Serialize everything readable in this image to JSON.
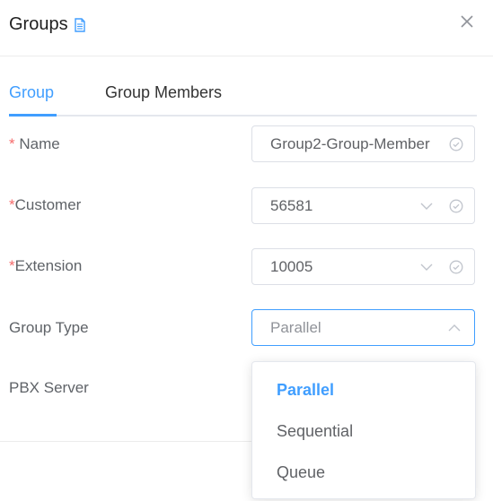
{
  "dialog": {
    "title": "Groups"
  },
  "tabs": [
    {
      "label": "Group",
      "active": true
    },
    {
      "label": "Group Members",
      "active": false
    }
  ],
  "form": {
    "name": {
      "required_mark": "* ",
      "label": "Name",
      "value": "Group2-Group-Member"
    },
    "customer": {
      "required_mark": "*",
      "label": "Customer",
      "value": "56581"
    },
    "extension": {
      "required_mark": "*",
      "label": "Extension",
      "value": "10005"
    },
    "group_type": {
      "label": "Group Type",
      "value": "Parallel"
    },
    "pbx_server": {
      "label": "PBX Server"
    }
  },
  "group_type_options": [
    "Parallel",
    "Sequential",
    "Queue"
  ],
  "selected_option": "Parallel",
  "colors": {
    "accent": "#409eff",
    "required": "#f56c6c"
  },
  "icons": [
    "document-icon",
    "close-icon",
    "chevron-down-icon",
    "chevron-up-icon",
    "check-circle-icon"
  ]
}
